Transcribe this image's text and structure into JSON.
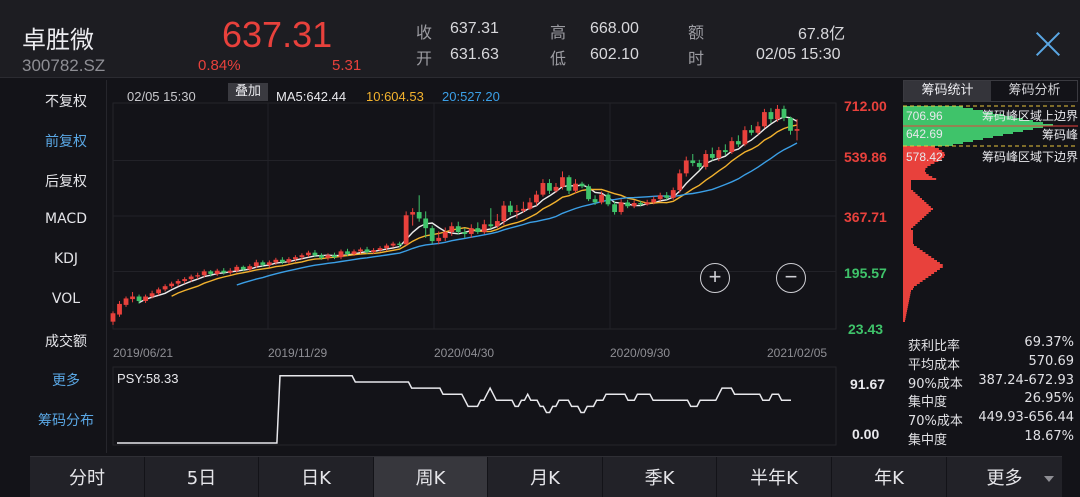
{
  "stock": {
    "name": "卓胜微",
    "code": "300782.SZ",
    "price": "637.31",
    "change_pct": "0.84%",
    "change_amt": "5.31"
  },
  "quote": {
    "shou_label": "收",
    "shou_value": "637.31",
    "kai_label": "开",
    "kai_value": "631.63",
    "gao_label": "高",
    "gao_value": "668.00",
    "di_label": "低",
    "di_value": "602.10",
    "e_label": "额",
    "e_value": "67.8亿",
    "shi_label": "时",
    "shi_value": "02/05 15:30"
  },
  "menu": [
    {
      "label": "不复权",
      "active": false
    },
    {
      "label": "前复权",
      "active": true
    },
    {
      "label": "后复权",
      "active": false
    },
    {
      "label": "MACD",
      "active": false
    },
    {
      "label": "KDJ",
      "active": false
    },
    {
      "label": "VOL",
      "active": false
    },
    {
      "label": "成交额",
      "active": false
    },
    {
      "label": "更多",
      "active": true
    },
    {
      "label": "筹码分布",
      "active": true
    }
  ],
  "main_header": {
    "date": "02/05 15:30",
    "overlay_label": "叠加",
    "ma5_label": "MA5:642.44",
    "ma10_label": "10:604.53",
    "ma20_label": "20:527.20"
  },
  "right_panel": {
    "tabs": [
      "筹码统计",
      "筹码分析"
    ],
    "peak_upper_price": "706.96",
    "peak_upper_label": "筹码峰区域上边界",
    "peak_price": "642.69",
    "peak_label": "筹码峰",
    "peak_lower_price": "578.42",
    "peak_lower_label": "筹码峰区域下边界",
    "stats": [
      {
        "label": "获利比率",
        "value": "69.37%"
      },
      {
        "label": "平均成本",
        "value": "570.69"
      },
      {
        "label": "90%成本",
        "value": "387.24-672.93"
      },
      {
        "label": "集中度",
        "value": "26.95%"
      },
      {
        "label": "70%成本",
        "value": "449.93-656.44"
      },
      {
        "label": "集中度",
        "value": "18.67%"
      }
    ]
  },
  "bottom_tabs": [
    "分时",
    "5日",
    "日K",
    "周K",
    "月K",
    "季K",
    "半年K",
    "年K",
    "更多"
  ],
  "active_bottom_tab": "周K",
  "colors": {
    "up": "#e8413c",
    "down": "#3fc36a",
    "ma5": "#ececec",
    "ma10": "#f2b22e",
    "ma20": "#3b9fe6",
    "accent": "#5aa7e4"
  },
  "chart_data": [
    {
      "type": "candlestick",
      "title": "",
      "y_axis_labels": [
        "712.00",
        "539.86",
        "367.71",
        "195.57",
        "23.43"
      ],
      "ylim": [
        23.43,
        712.0
      ],
      "x_tick_labels": [
        "2019/06/21",
        "2019/11/29",
        "2020/04/30",
        "2020/09/30",
        "2021/02/05"
      ],
      "moving_averages": {
        "MA5": 642.44,
        "MA10": 604.53,
        "MA20": 527.2
      },
      "candles": [
        {
          "o": 40,
          "c": 66,
          "h": 72,
          "l": 30
        },
        {
          "o": 62,
          "c": 95,
          "h": 104,
          "l": 55
        },
        {
          "o": 92,
          "c": 112,
          "h": 118,
          "l": 86
        },
        {
          "o": 110,
          "c": 118,
          "h": 132,
          "l": 100
        },
        {
          "o": 118,
          "c": 104,
          "h": 124,
          "l": 96
        },
        {
          "o": 104,
          "c": 118,
          "h": 124,
          "l": 98
        },
        {
          "o": 118,
          "c": 128,
          "h": 136,
          "l": 112
        },
        {
          "o": 128,
          "c": 140,
          "h": 146,
          "l": 122
        },
        {
          "o": 140,
          "c": 150,
          "h": 156,
          "l": 134
        },
        {
          "o": 150,
          "c": 158,
          "h": 164,
          "l": 144
        },
        {
          "o": 158,
          "c": 166,
          "h": 172,
          "l": 150
        },
        {
          "o": 166,
          "c": 172,
          "h": 178,
          "l": 158
        },
        {
          "o": 172,
          "c": 180,
          "h": 186,
          "l": 164
        },
        {
          "o": 180,
          "c": 184,
          "h": 192,
          "l": 172
        },
        {
          "o": 184,
          "c": 196,
          "h": 202,
          "l": 178
        },
        {
          "o": 196,
          "c": 188,
          "h": 200,
          "l": 180
        },
        {
          "o": 188,
          "c": 198,
          "h": 204,
          "l": 182
        },
        {
          "o": 198,
          "c": 192,
          "h": 206,
          "l": 186
        },
        {
          "o": 192,
          "c": 198,
          "h": 206,
          "l": 186
        },
        {
          "o": 198,
          "c": 210,
          "h": 216,
          "l": 192
        },
        {
          "o": 210,
          "c": 202,
          "h": 214,
          "l": 196
        },
        {
          "o": 202,
          "c": 212,
          "h": 218,
          "l": 196
        },
        {
          "o": 212,
          "c": 224,
          "h": 232,
          "l": 206
        },
        {
          "o": 224,
          "c": 216,
          "h": 230,
          "l": 210
        },
        {
          "o": 216,
          "c": 224,
          "h": 230,
          "l": 208
        },
        {
          "o": 224,
          "c": 232,
          "h": 238,
          "l": 216
        },
        {
          "o": 232,
          "c": 224,
          "h": 240,
          "l": 218
        },
        {
          "o": 224,
          "c": 234,
          "h": 240,
          "l": 218
        },
        {
          "o": 234,
          "c": 240,
          "h": 246,
          "l": 226
        },
        {
          "o": 240,
          "c": 246,
          "h": 252,
          "l": 232
        },
        {
          "o": 246,
          "c": 254,
          "h": 260,
          "l": 240
        },
        {
          "o": 254,
          "c": 246,
          "h": 262,
          "l": 240
        },
        {
          "o": 246,
          "c": 238,
          "h": 252,
          "l": 232
        },
        {
          "o": 238,
          "c": 246,
          "h": 252,
          "l": 230
        },
        {
          "o": 246,
          "c": 240,
          "h": 254,
          "l": 234
        },
        {
          "o": 240,
          "c": 258,
          "h": 264,
          "l": 234
        },
        {
          "o": 258,
          "c": 250,
          "h": 266,
          "l": 244
        },
        {
          "o": 250,
          "c": 258,
          "h": 264,
          "l": 244
        },
        {
          "o": 258,
          "c": 264,
          "h": 270,
          "l": 250
        },
        {
          "o": 264,
          "c": 256,
          "h": 272,
          "l": 250
        },
        {
          "o": 256,
          "c": 262,
          "h": 268,
          "l": 250
        },
        {
          "o": 262,
          "c": 268,
          "h": 274,
          "l": 256
        },
        {
          "o": 268,
          "c": 276,
          "h": 282,
          "l": 260
        },
        {
          "o": 276,
          "c": 282,
          "h": 288,
          "l": 270
        },
        {
          "o": 282,
          "c": 278,
          "h": 288,
          "l": 270
        },
        {
          "o": 280,
          "c": 370,
          "h": 382,
          "l": 276
        },
        {
          "o": 372,
          "c": 380,
          "h": 392,
          "l": 338
        },
        {
          "o": 380,
          "c": 360,
          "h": 432,
          "l": 350
        },
        {
          "o": 360,
          "c": 330,
          "h": 382,
          "l": 300
        },
        {
          "o": 330,
          "c": 290,
          "h": 338,
          "l": 282
        },
        {
          "o": 290,
          "c": 300,
          "h": 320,
          "l": 280
        },
        {
          "o": 300,
          "c": 318,
          "h": 332,
          "l": 290
        },
        {
          "o": 318,
          "c": 336,
          "h": 348,
          "l": 306
        },
        {
          "o": 336,
          "c": 318,
          "h": 350,
          "l": 310
        },
        {
          "o": 318,
          "c": 312,
          "h": 330,
          "l": 300
        },
        {
          "o": 312,
          "c": 330,
          "h": 342,
          "l": 300
        },
        {
          "o": 330,
          "c": 318,
          "h": 348,
          "l": 312
        },
        {
          "o": 318,
          "c": 342,
          "h": 356,
          "l": 312
        },
        {
          "o": 342,
          "c": 336,
          "h": 392,
          "l": 328
        },
        {
          "o": 336,
          "c": 352,
          "h": 374,
          "l": 330
        },
        {
          "o": 352,
          "c": 400,
          "h": 414,
          "l": 340
        },
        {
          "o": 400,
          "c": 380,
          "h": 414,
          "l": 370
        },
        {
          "o": 380,
          "c": 384,
          "h": 402,
          "l": 360
        },
        {
          "o": 384,
          "c": 390,
          "h": 412,
          "l": 378
        },
        {
          "o": 390,
          "c": 410,
          "h": 424,
          "l": 386
        },
        {
          "o": 410,
          "c": 434,
          "h": 446,
          "l": 400
        },
        {
          "o": 434,
          "c": 470,
          "h": 482,
          "l": 428
        },
        {
          "o": 470,
          "c": 446,
          "h": 482,
          "l": 436
        },
        {
          "o": 446,
          "c": 458,
          "h": 470,
          "l": 440
        },
        {
          "o": 458,
          "c": 488,
          "h": 506,
          "l": 450
        },
        {
          "o": 488,
          "c": 446,
          "h": 494,
          "l": 436
        },
        {
          "o": 446,
          "c": 468,
          "h": 482,
          "l": 438
        },
        {
          "o": 468,
          "c": 460,
          "h": 474,
          "l": 454
        },
        {
          "o": 460,
          "c": 420,
          "h": 466,
          "l": 414
        },
        {
          "o": 420,
          "c": 410,
          "h": 432,
          "l": 402
        },
        {
          "o": 410,
          "c": 434,
          "h": 444,
          "l": 404
        },
        {
          "o": 434,
          "c": 404,
          "h": 440,
          "l": 398
        },
        {
          "o": 404,
          "c": 380,
          "h": 414,
          "l": 372
        },
        {
          "o": 380,
          "c": 410,
          "h": 420,
          "l": 372
        },
        {
          "o": 410,
          "c": 398,
          "h": 418,
          "l": 392
        },
        {
          "o": 398,
          "c": 408,
          "h": 416,
          "l": 392
        },
        {
          "o": 408,
          "c": 404,
          "h": 414,
          "l": 398
        },
        {
          "o": 404,
          "c": 410,
          "h": 418,
          "l": 400
        },
        {
          "o": 410,
          "c": 420,
          "h": 428,
          "l": 404
        },
        {
          "o": 420,
          "c": 432,
          "h": 440,
          "l": 414
        },
        {
          "o": 432,
          "c": 424,
          "h": 442,
          "l": 418
        },
        {
          "o": 424,
          "c": 448,
          "h": 456,
          "l": 418
        },
        {
          "o": 448,
          "c": 500,
          "h": 512,
          "l": 440
        },
        {
          "o": 500,
          "c": 540,
          "h": 552,
          "l": 490
        },
        {
          "o": 540,
          "c": 532,
          "h": 560,
          "l": 522
        },
        {
          "o": 532,
          "c": 520,
          "h": 542,
          "l": 510
        },
        {
          "o": 520,
          "c": 560,
          "h": 572,
          "l": 512
        },
        {
          "o": 560,
          "c": 548,
          "h": 580,
          "l": 540
        },
        {
          "o": 548,
          "c": 572,
          "h": 582,
          "l": 538
        },
        {
          "o": 572,
          "c": 566,
          "h": 590,
          "l": 556
        },
        {
          "o": 566,
          "c": 600,
          "h": 612,
          "l": 560
        },
        {
          "o": 600,
          "c": 590,
          "h": 618,
          "l": 582
        },
        {
          "o": 590,
          "c": 634,
          "h": 646,
          "l": 584
        },
        {
          "o": 634,
          "c": 626,
          "h": 650,
          "l": 618
        },
        {
          "o": 626,
          "c": 646,
          "h": 660,
          "l": 620
        },
        {
          "o": 646,
          "c": 690,
          "h": 700,
          "l": 640
        },
        {
          "o": 690,
          "c": 668,
          "h": 702,
          "l": 656
        },
        {
          "o": 668,
          "c": 700,
          "h": 712,
          "l": 660
        },
        {
          "o": 700,
          "c": 672,
          "h": 710,
          "l": 662
        },
        {
          "o": 672,
          "c": 632,
          "h": 676,
          "l": 620
        },
        {
          "o": 632,
          "c": 637.31,
          "h": 668,
          "l": 602.1
        }
      ]
    },
    {
      "type": "line",
      "title": "",
      "series": [
        {
          "name": "PSY:58.33",
          "values": [
            0,
            0,
            0,
            0,
            0,
            0,
            0,
            0,
            0,
            0,
            0,
            0,
            0,
            0,
            0,
            0,
            0,
            0,
            0,
            0,
            0,
            0,
            0,
            0,
            0,
            0,
            0,
            0,
            0,
            0,
            0,
            0,
            0,
            0,
            0,
            0,
            0,
            0,
            0,
            0,
            0,
            0,
            0,
            0,
            0,
            0,
            0,
            0,
            0,
            0,
            0,
            0,
            91.67,
            91.67,
            91.67,
            91.67,
            91.67,
            91.67,
            91.67,
            91.67,
            91.67,
            91.67,
            91.67,
            91.67,
            91.67,
            91.67,
            91.67,
            91.67,
            91.67,
            91.67,
            91.67,
            91.67,
            91.67,
            91.67,
            91.67,
            91.67,
            83.33,
            83.33,
            83.33,
            83.33,
            83.33,
            83.33,
            83.33,
            83.33,
            83.33,
            83.33,
            83.33,
            83.33,
            83.33,
            83.33,
            83.33,
            83.33,
            83.33,
            83.33,
            75,
            75,
            75,
            75,
            75,
            75,
            75,
            75,
            75,
            75,
            66.67,
            66.67,
            66.67,
            66.67,
            66.67,
            66.67,
            66.67,
            58.33,
            50,
            50,
            50,
            50,
            58.33,
            58.33,
            66.67,
            75,
            66.67,
            58.33,
            58.33,
            58.33,
            58.33,
            58.33,
            58.33,
            50,
            50,
            58.33,
            58.33,
            66.67,
            58.33,
            58.33,
            58.33,
            50,
            50,
            41.67,
            41.67,
            50,
            50,
            58.33,
            58.33,
            58.33,
            58.33,
            50,
            50,
            50,
            41.67,
            41.67,
            50,
            50,
            50,
            58.33,
            58.33,
            58.33,
            66.67,
            66.67,
            66.67,
            66.67,
            66.67,
            66.67,
            66.67,
            58.33,
            58.33,
            58.33,
            66.67,
            66.67,
            66.67,
            66.67,
            66.67,
            58.33,
            58.33,
            58.33,
            58.33,
            58.33,
            58.33,
            58.33,
            58.33,
            58.33,
            58.33,
            58.33,
            58.33,
            50,
            50,
            50,
            58.33,
            58.33,
            58.33,
            58.33,
            58.33,
            58.33,
            66.67,
            75,
            75,
            75,
            75,
            66.67,
            66.67,
            66.67,
            66.67,
            66.67,
            66.67,
            66.67,
            66.67,
            66.67,
            58.33,
            58.33,
            58.33,
            66.67,
            66.67,
            66.67,
            58.33,
            58.33,
            58.33,
            58.33
          ]
        }
      ],
      "y_axis_labels": [
        "91.67",
        "0.00"
      ],
      "ylim": [
        0,
        100
      ]
    }
  ]
}
